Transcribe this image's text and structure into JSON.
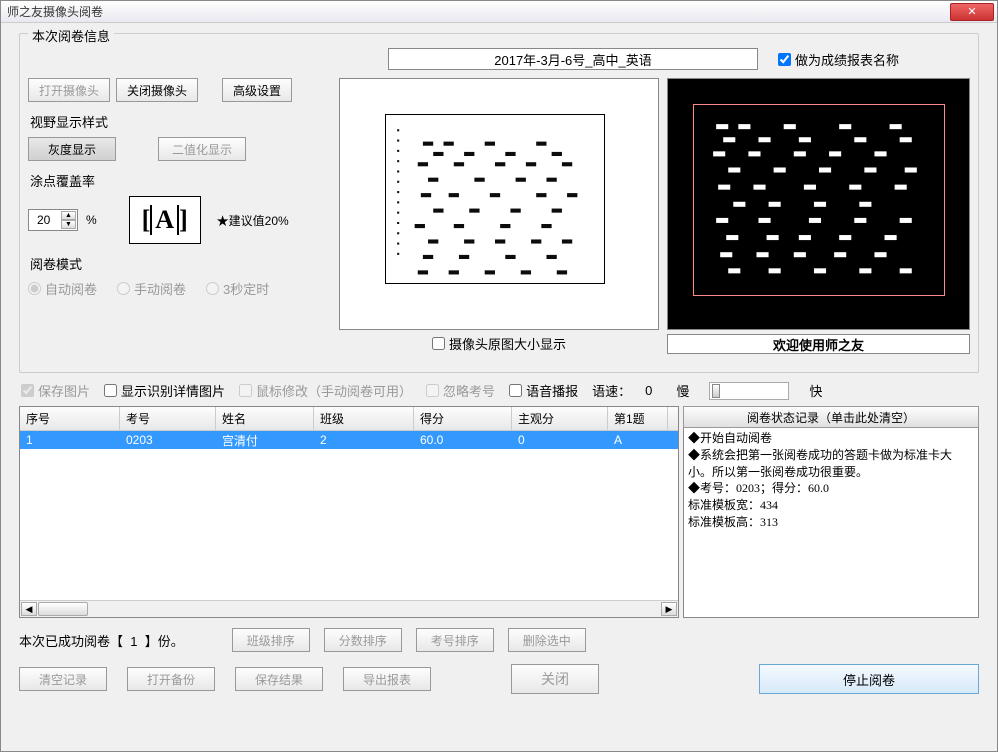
{
  "title": "师之友摄像头阅卷",
  "info": {
    "group_title": "本次阅卷信息",
    "exam_name": "2017年-3月-6号_高中_英语",
    "use_as_report_name": "做为成绩报表名称"
  },
  "camera": {
    "open": "打开摄像头",
    "close": "关闭摄像头",
    "advanced": "高级设置",
    "view_style_label": "视野显示样式",
    "gray": "灰度显示",
    "binary": "二值化显示",
    "coverage_label": "涂点覆盖率",
    "coverage_value": "20",
    "percent": "%",
    "thumb_letter": "A",
    "suggest": "★建议值20%",
    "mode_label": "阅卷模式",
    "mode_auto": "自动阅卷",
    "mode_manual": "手动阅卷",
    "mode_timed": "3秒定时"
  },
  "view": {
    "original_size": "摄像头原图大小显示",
    "welcome": "欢迎使用师之友"
  },
  "options": {
    "save_img": "保存图片",
    "show_detail": "显示识别详情图片",
    "mouse_edit": "鼠标修改（手动阅卷可用）",
    "ignore_id": "忽略考号",
    "voice": "语音播报",
    "speed_label": "语速：",
    "speed_value": "0",
    "slow": "慢",
    "fast": "快"
  },
  "table": {
    "headers": {
      "seq": "序号",
      "id": "考号",
      "name": "姓名",
      "class": "班级",
      "score": "得分",
      "subj": "主观分",
      "q1": "第1题"
    },
    "rows": [
      {
        "seq": "1",
        "id": "0203",
        "name": "宫清付",
        "class": "2",
        "score": "60.0",
        "subj": "0",
        "q1": "A"
      }
    ]
  },
  "log": {
    "header": "阅卷状态记录（单击此处清空）",
    "lines": [
      "◆开始自动阅卷",
      "◆系统会把第一张阅卷成功的答题卡做为标准卡大小。所以第一张阅卷成功很重要。",
      "◆考号：0203；得分：60.0",
      "标准模板宽：434",
      "标准模板高：313"
    ]
  },
  "bottom": {
    "done_prefix": "本次已成功阅卷【",
    "done_count": "1",
    "done_suffix": "】份。",
    "sort_class": "班级排序",
    "sort_score": "分数排序",
    "sort_id": "考号排序",
    "delete_sel": "删除选中",
    "clear": "清空记录",
    "open_backup": "打开备份",
    "save_result": "保存结果",
    "export": "导出报表",
    "close": "关闭",
    "stop": "停止阅卷"
  }
}
